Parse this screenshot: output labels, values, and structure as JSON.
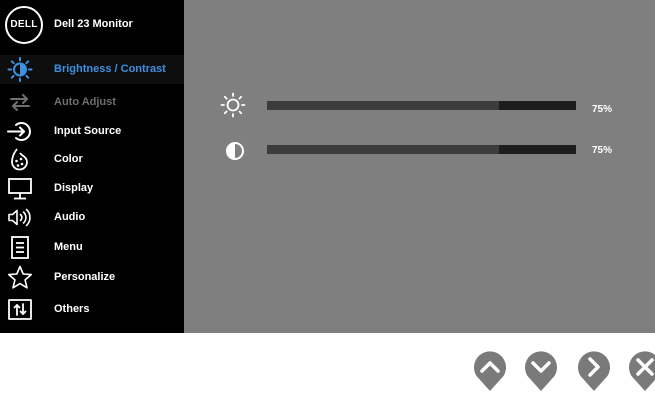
{
  "header": {
    "logo_text": "DELL",
    "model": "Dell 23 Monitor"
  },
  "menu": [
    {
      "label": "Brightness / Contrast",
      "icon": "sun-icon",
      "state": "selected"
    },
    {
      "label": "Auto Adjust",
      "icon": "auto-adjust-icon",
      "state": "disabled"
    },
    {
      "label": "Input Source",
      "icon": "input-source-icon",
      "state": "normal"
    },
    {
      "label": "Color",
      "icon": "palette-icon",
      "state": "normal"
    },
    {
      "label": "Display",
      "icon": "monitor-icon",
      "state": "normal"
    },
    {
      "label": "Audio",
      "icon": "speaker-icon",
      "state": "normal"
    },
    {
      "label": "Menu",
      "icon": "menu-icon",
      "state": "normal"
    },
    {
      "label": "Personalize",
      "icon": "star-icon",
      "state": "normal"
    },
    {
      "label": "Others",
      "icon": "others-icon",
      "state": "normal"
    }
  ],
  "controls": {
    "brightness": {
      "icon": "brightness-sun-icon",
      "value": 75,
      "value_label": "75%"
    },
    "contrast": {
      "icon": "contrast-icon",
      "value": 75,
      "value_label": "75%"
    }
  },
  "nav_buttons": [
    {
      "name": "up-button",
      "icon": "chevron-up-icon"
    },
    {
      "name": "down-button",
      "icon": "chevron-down-icon"
    },
    {
      "name": "right-button",
      "icon": "chevron-right-icon"
    },
    {
      "name": "exit-button",
      "icon": "close-icon"
    }
  ],
  "colors": {
    "osd_background": "#7f7f7f",
    "sidebar_background": "#000000",
    "selected_label": "#3d8fe0",
    "disabled_label": "#6f6f6f",
    "nav_button": "#7a7a7a"
  }
}
